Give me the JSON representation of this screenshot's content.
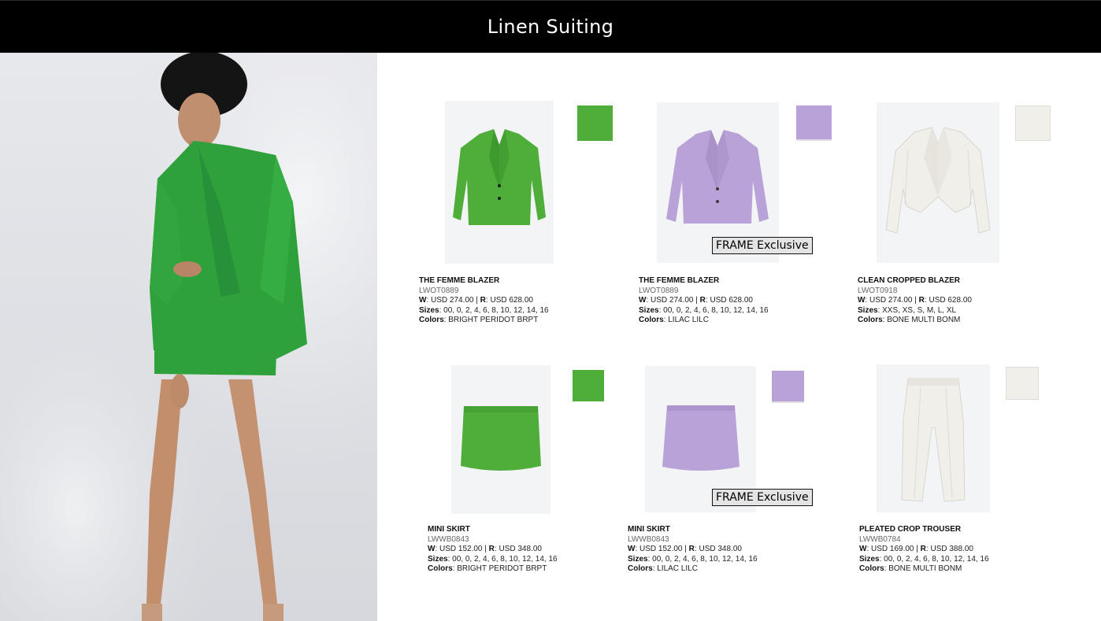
{
  "page": {
    "title": "Linen Suiting"
  },
  "colors": {
    "header_bg": "#000000",
    "peridot": "#4fae3a",
    "lilac": "#b9a2d8",
    "bone": "#f0efea",
    "hero_jacket": "#2ea13a"
  },
  "hero": {
    "icon": "model-photo"
  },
  "products": [
    {
      "name": "THE FEMME BLAZER",
      "sku": "LWOT0889",
      "w_label": "W",
      "w_value": "USD 274.00",
      "sep": "|",
      "r_label": "R",
      "r_value": "USD 628.00",
      "sizes_label": "Sizes",
      "sizes": "00, 0, 2, 4, 6, 8, 10, 12, 14, 16",
      "colors_label": "Colors",
      "colors": "BRIGHT PERIDOT BRPT",
      "badge": "",
      "icon": "blazer-icon"
    },
    {
      "name": "THE FEMME BLAZER",
      "sku": "LWOT0889",
      "w_label": "W",
      "w_value": "USD 274.00",
      "sep": "|",
      "r_label": "R",
      "r_value": "USD 628.00",
      "sizes_label": "Sizes",
      "sizes": "00, 0, 2, 4, 6, 8, 10, 12, 14, 16",
      "colors_label": "Colors",
      "colors": "LILAC LILC",
      "badge": "FRAME Exclusive",
      "icon": "blazer-icon"
    },
    {
      "name": "CLEAN CROPPED BLAZER",
      "sku": "LWOT0918",
      "w_label": "W",
      "w_value": "USD 274.00",
      "sep": "|",
      "r_label": "R",
      "r_value": "USD 628.00",
      "sizes_label": "Sizes",
      "sizes": "XXS, XS, S, M, L, XL",
      "colors_label": "Colors",
      "colors": "BONE MULTI BONM",
      "badge": "",
      "icon": "cropped-blazer-icon"
    },
    {
      "name": "MINI SKIRT",
      "sku": "LWWB0843",
      "w_label": "W",
      "w_value": "USD 152.00",
      "sep": "|",
      "r_label": "R",
      "r_value": "USD 348.00",
      "sizes_label": "Sizes",
      "sizes": "00, 0, 2, 4, 6, 8, 10, 12, 14, 16",
      "colors_label": "Colors",
      "colors": "BRIGHT PERIDOT BRPT",
      "badge": "",
      "icon": "skirt-icon"
    },
    {
      "name": "MINI SKIRT",
      "sku": "LWWB0843",
      "w_label": "W",
      "w_value": "USD 152.00",
      "sep": "|",
      "r_label": "R",
      "r_value": "USD 348.00",
      "sizes_label": "Sizes",
      "sizes": "00, 0, 2, 4, 6, 8, 10, 12, 14, 16",
      "colors_label": "Colors",
      "colors": "LILAC LILC",
      "badge": "FRAME Exclusive",
      "icon": "skirt-icon"
    },
    {
      "name": "PLEATED CROP TROUSER",
      "sku": "LWWB0784",
      "w_label": "W",
      "w_value": "USD 169.00",
      "sep": "|",
      "r_label": "R",
      "r_value": "USD 388.00",
      "sizes_label": "Sizes",
      "sizes": "00, 0, 2, 4, 6, 8, 10, 12, 14, 16",
      "colors_label": "Colors",
      "colors": "BONE MULTI BONM",
      "badge": "",
      "icon": "trouser-icon"
    }
  ]
}
